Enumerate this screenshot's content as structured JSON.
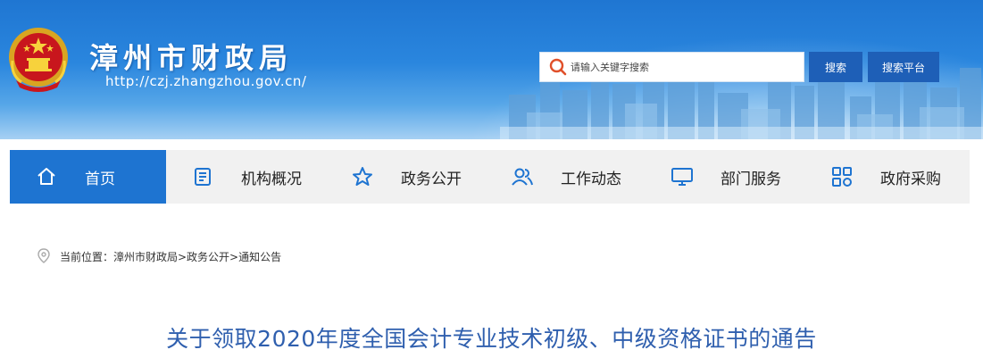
{
  "header": {
    "site_title": "漳州市财政局",
    "site_url": "http://czj.zhangzhou.gov.cn/",
    "emblem": "national-emblem",
    "search": {
      "placeholder": "请输入关键字搜索",
      "value": "",
      "search_button": "搜索",
      "platform_button": "搜索平台"
    }
  },
  "nav": {
    "items": [
      {
        "label": "首页",
        "icon": "home-icon",
        "active": true
      },
      {
        "label": "机构概况",
        "icon": "document-icon",
        "active": false
      },
      {
        "label": "政务公开",
        "icon": "star-icon",
        "active": false
      },
      {
        "label": "工作动态",
        "icon": "users-icon",
        "active": false
      },
      {
        "label": "部门服务",
        "icon": "monitor-icon",
        "active": false
      },
      {
        "label": "政府采购",
        "icon": "grid-icon",
        "active": false
      }
    ]
  },
  "breadcrumb": {
    "icon": "location-pin-icon",
    "text": "当前位置：漳州市财政局>政务公开>通知公告"
  },
  "article": {
    "title": "关于领取2020年度全国会计专业技术初级、中级资格证书的通告"
  },
  "colors": {
    "nav_active": "#1e74d1",
    "button": "#1e5fb7",
    "title": "#2f5fae",
    "search_icon": "#e0502a"
  }
}
